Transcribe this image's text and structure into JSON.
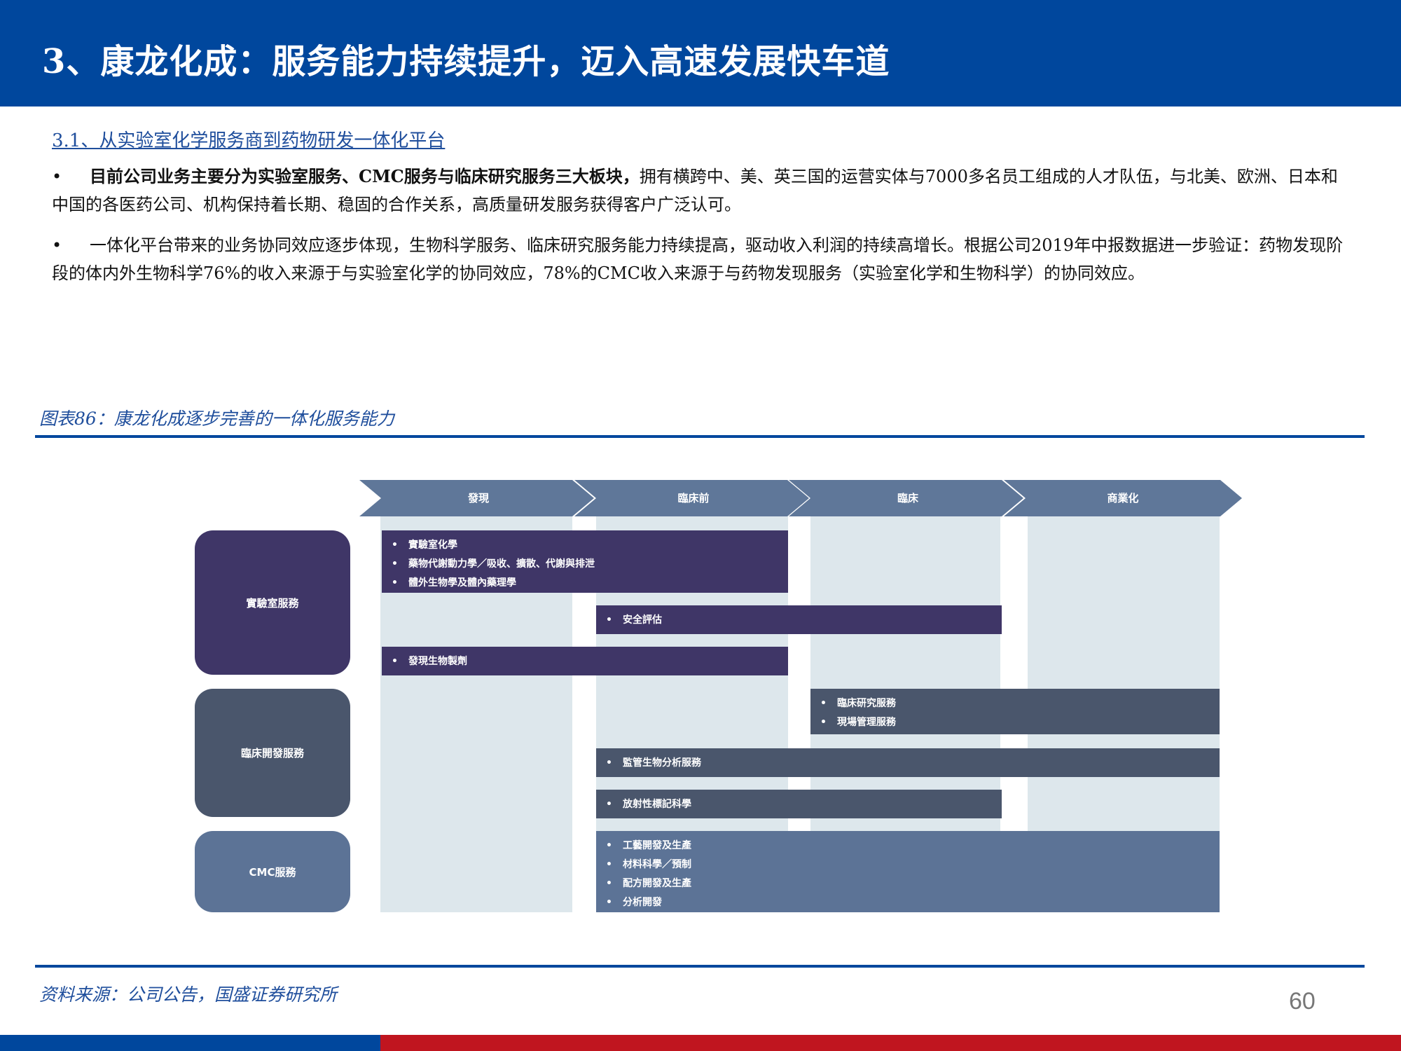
{
  "header": {
    "title": "3、康龙化成：服务能力持续提升，迈入高速发展快车道"
  },
  "section": {
    "subheading": "3.1、从实验室化学服务商到药物研发一体化平台",
    "bullet_symbol": "•",
    "paragraphs": [
      {
        "bold": "目前公司业务主要分为实验室服务、CMC服务与临床研究服务三大板块，",
        "text": "拥有横跨中、美、英三国的运营实体与7000多名员工组成的人才队伍，与北美、欧洲、日本和中国的各医药公司、机构保持着长期、稳固的合作关系，高质量研发服务获得客户广泛认可。"
      },
      {
        "text": "一体化平台带来的业务协同效应逐步体现，生物科学服务、临床研究服务能力持续提高，驱动收入利润的持续高增长。根据公司2019年中报数据进一步验证：药物发现阶段的体内外生物科学76%的收入来源于与实验室化学的协同效应，78%的CMC收入来源于与药物发现服务（实验室化学和生物科学）的协同效应。"
      }
    ]
  },
  "figure": {
    "title": "图表86：康龙化成逐步完善的一体化服务能力",
    "stages": [
      "發現",
      "臨床前",
      "臨床",
      "商業化"
    ],
    "groups": [
      "實驗室服務",
      "臨床開發服務",
      "CMC服務"
    ],
    "bars": [
      {
        "items": [
          "實驗室化學",
          "藥物代謝動力學／吸收、擴散、代謝與排泄",
          "體外生物學及體內藥理學"
        ]
      },
      {
        "items": [
          "安全評估"
        ]
      },
      {
        "items": [
          "發現生物製劑"
        ]
      },
      {
        "items": [
          "臨床研究服務",
          "現場管理服務"
        ]
      },
      {
        "items": [
          "監管生物分析服務"
        ]
      },
      {
        "items": [
          "放射性標記科學"
        ]
      },
      {
        "items": [
          "工藝開發及生產",
          "材料科學／預制",
          "配方開發及生產",
          "分析開發"
        ]
      }
    ],
    "colors": {
      "lab": "#3f3667",
      "clinical": "#4a566c",
      "cmc": "#5c7396",
      "stage_arrow": "#5f7799",
      "column_bg": "#dde7ec"
    }
  },
  "footer": {
    "source": "资料来源：公司公告，国盛证券研究所",
    "page_number": "60"
  },
  "colors": {
    "brand_blue": "#00479d",
    "accent_red": "#c0151f"
  }
}
